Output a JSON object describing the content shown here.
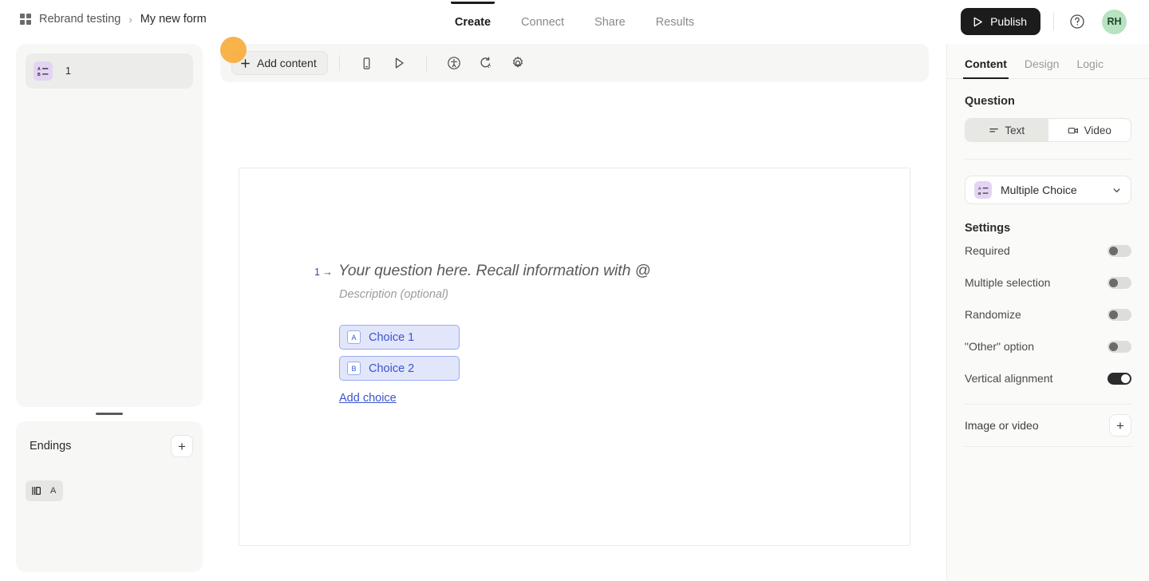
{
  "breadcrumb": {
    "icon": "grid-icon",
    "workspace": "Rebrand testing",
    "separator": "›",
    "current": "My new form"
  },
  "nav_tabs": [
    {
      "label": "Create",
      "active": true
    },
    {
      "label": "Connect",
      "active": false
    },
    {
      "label": "Share",
      "active": false
    },
    {
      "label": "Results",
      "active": false
    }
  ],
  "topright": {
    "publish_label": "Publish",
    "publish_icon": "send-icon",
    "help_icon": "question-circle-icon",
    "avatar_initials": "RH",
    "avatar_color": "#b7e3c0"
  },
  "sidebar": {
    "questions": [
      {
        "badge_icon": "multiple-choice-icon",
        "number": "1"
      }
    ],
    "endings": {
      "title": "Endings",
      "add_label": "+",
      "items": [
        {
          "icon": "ending-flag-icon",
          "letter": "A"
        }
      ]
    }
  },
  "toolbar": {
    "add_content_label": "Add content",
    "add_content_icon": "plus-icon",
    "buttons": [
      {
        "name": "mobile-preview-icon"
      },
      {
        "name": "play-preview-icon"
      },
      {
        "name": "accessibility-icon"
      },
      {
        "name": "refresh-icon"
      },
      {
        "name": "gear-icon"
      }
    ]
  },
  "cursor_indicator_color": "#f9ad3c",
  "canvas": {
    "question_index": "1",
    "question_arrow": "→",
    "question_title": "Your question here. Recall information with @",
    "question_description": "Description (optional)",
    "choices": [
      {
        "letter": "A",
        "text": "Choice 1"
      },
      {
        "letter": "B",
        "text": "Choice 2"
      }
    ],
    "add_choice_label": "Add choice"
  },
  "right_panel": {
    "tabs": [
      {
        "label": "Content",
        "active": true
      },
      {
        "label": "Design",
        "active": false
      },
      {
        "label": "Logic",
        "active": false
      }
    ],
    "question_section_label": "Question",
    "media_segment": [
      {
        "label": "Text",
        "icon": "text-lines-icon",
        "active": true
      },
      {
        "label": "Video",
        "icon": "video-camera-icon",
        "active": false
      }
    ],
    "question_type": {
      "icon": "multiple-choice-icon",
      "label": "Multiple Choice",
      "chevron": "chevron-down-icon"
    },
    "settings_title": "Settings",
    "settings": [
      {
        "label": "Required",
        "value": false
      },
      {
        "label": "Multiple selection",
        "value": false
      },
      {
        "label": "Randomize",
        "value": false
      },
      {
        "label": "\"Other\" option",
        "value": false
      },
      {
        "label": "Vertical alignment",
        "value": true
      }
    ],
    "image_or_video": {
      "label": "Image or video",
      "add_label": "+"
    }
  }
}
